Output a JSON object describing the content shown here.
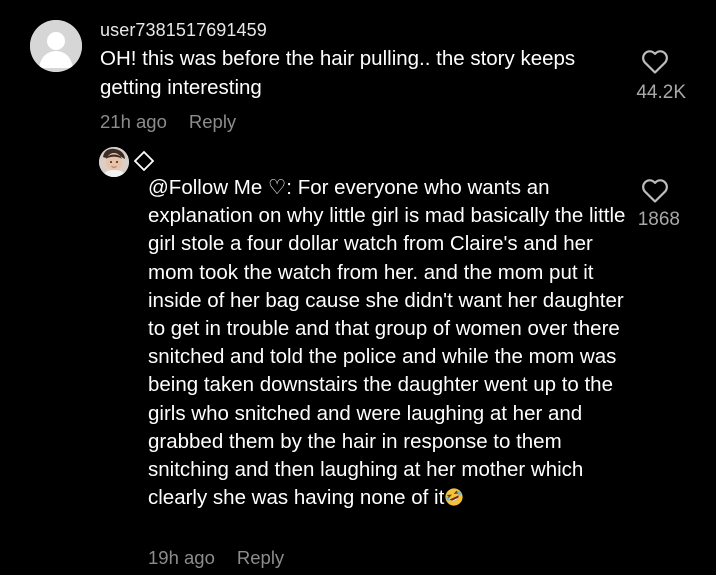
{
  "comments": [
    {
      "username": "user7381517691459",
      "text": "OH! this was before the hair pulling.. the story keeps getting interesting",
      "time": "21h ago",
      "reply_label": "Reply",
      "like_count": "44.2K",
      "avatar_icon": "default-avatar-icon"
    }
  ],
  "reply": {
    "mention": "@Follow Me ♡",
    "text_after_mention": ": For everyone who wants an explanation on why little girl is mad basically the little girl stole a four dollar watch from Claire's and her mom took the watch from her. and the mom put it inside of her bag cause she didn't want her daughter to get in trouble and that group of women over there snitched and told the police and while the mom was being taken downstairs the daughter went up to the girls who snitched and were laughing at her and grabbed them by the hair in response to them snitching and then laughing at her mother which clearly she was having none of it",
    "trailing_emoji": "rolling-on-floor-laughing-emoji",
    "time": "19h ago",
    "reply_label": "Reply",
    "like_count": "1868",
    "badge_icon": "diamond-icon"
  },
  "colors": {
    "background": "#000000",
    "primary_text": "#ffffff",
    "secondary_text": "#8c8c8c",
    "count_text": "#a8a8a8"
  }
}
